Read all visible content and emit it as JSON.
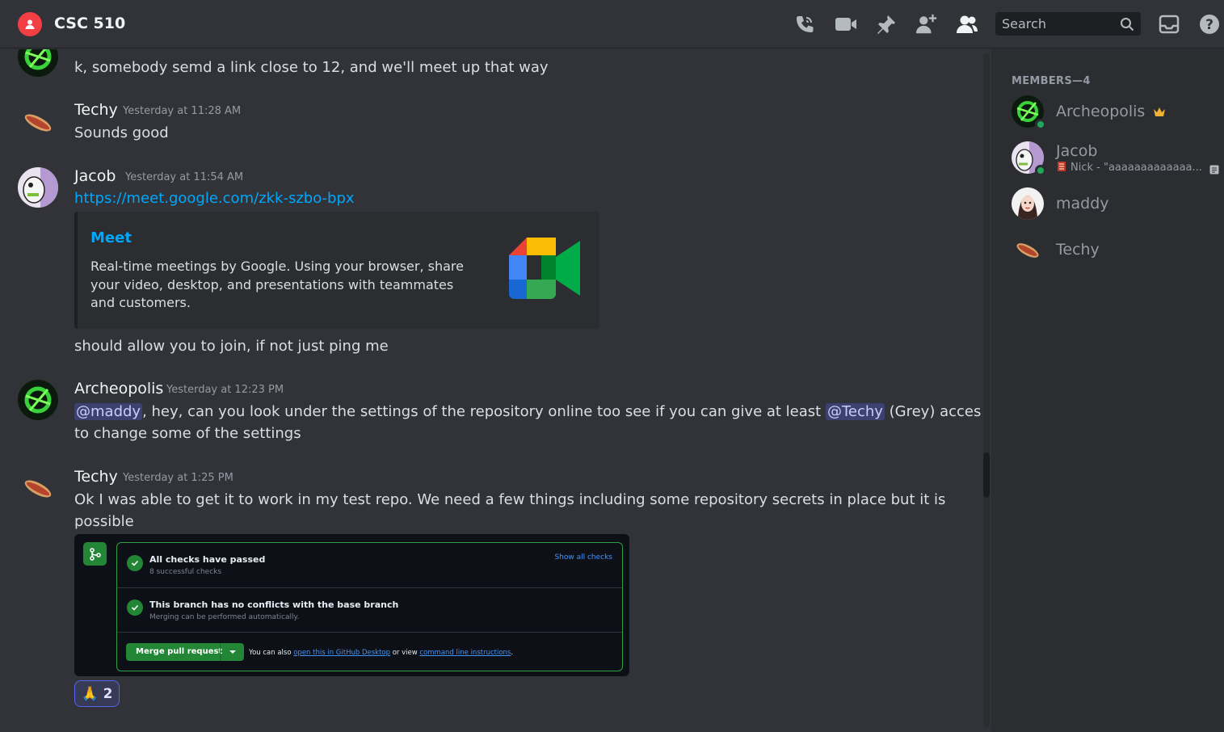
{
  "header": {
    "title": "CSC 510",
    "search_placeholder": "Search"
  },
  "messages": [
    {
      "text": "k, somebody semd a link close to 12, and we'll meet up that way"
    },
    {
      "author": "Techy",
      "timestamp": "Yesterday at 11:28 AM",
      "text": "Sounds good"
    },
    {
      "author": "Jacob",
      "timestamp": "Yesterday at 11:54 AM",
      "link": "https://meet.google.com/zkk-szbo-bpx",
      "embed": {
        "title": "Meet",
        "description": "Real-time meetings by Google. Using your browser, share your video, desktop, and presentations with teammates and customers."
      },
      "text2": "should allow you to join, if not just ping me"
    },
    {
      "author": "Archeopolis",
      "timestamp": "Yesterday at 12:23 PM",
      "mention1": "@maddy",
      "text_a": ", hey, can you look under the settings of the repository online too see if you can give at least ",
      "mention2": "@Techy",
      "text_b": " (Grey) access",
      "text_c": "to change some of the settings"
    },
    {
      "author": "Techy",
      "timestamp": "Yesterday at 1:25 PM",
      "text": "Ok I was able to get it to work in my test repo. We need a few things including some repository secrets in place but it is",
      "text_cont": "possible",
      "attachment": {
        "check1_title": "All checks have passed",
        "check1_sub": "8 successful checks",
        "show_all": "Show all checks",
        "check2_title": "This branch has no conflicts with the base branch",
        "check2_sub": "Merging can be performed automatically.",
        "merge_label": "Merge pull request",
        "foot_a": "You can also ",
        "foot_link1": "open this in GitHub Desktop",
        "foot_b": " or view ",
        "foot_link2": "command line instructions",
        "foot_c": "."
      },
      "reaction": {
        "emoji": "🙏",
        "count": "2"
      }
    }
  ],
  "members": {
    "header": "MEMBERS—4",
    "list": [
      {
        "name": "Archeopolis"
      },
      {
        "name": "Jacob",
        "activity": "Nick - \"aaaaaaaaaaaaa..."
      },
      {
        "name": "maddy"
      },
      {
        "name": "Techy"
      }
    ]
  }
}
